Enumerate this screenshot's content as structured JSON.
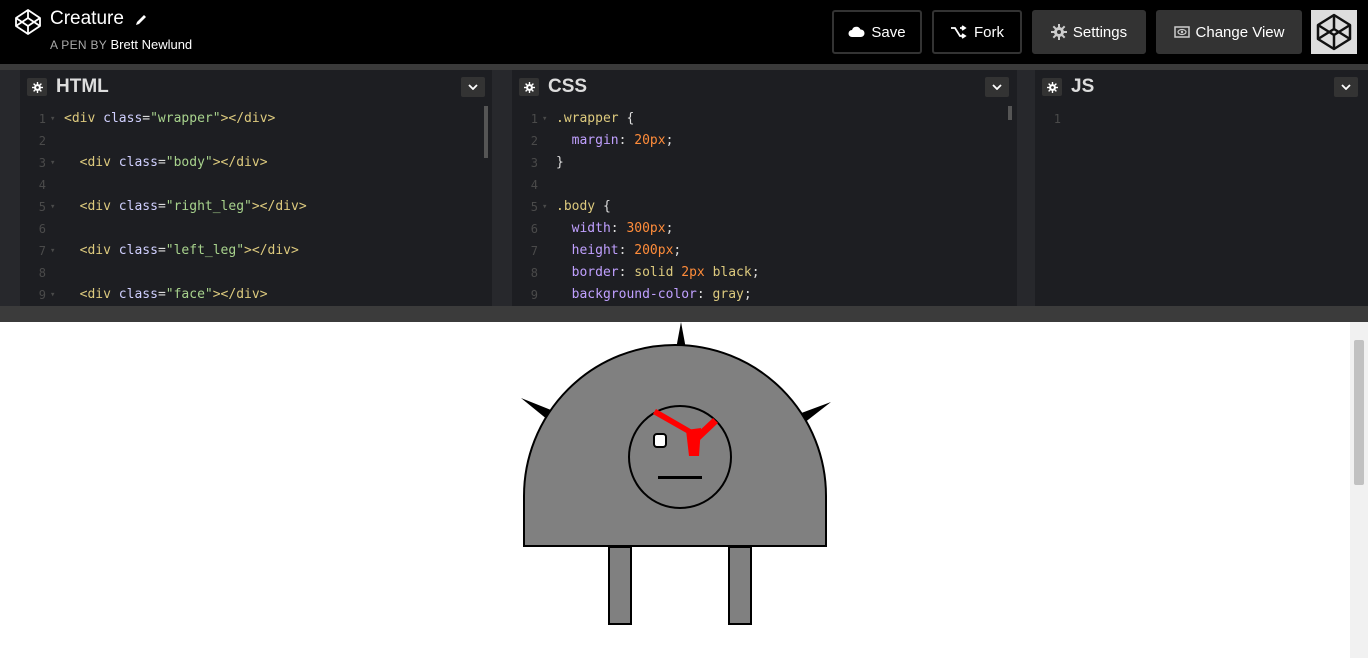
{
  "header": {
    "title": "Creature",
    "byline_prefix": "A PEN BY",
    "author": "Brett Newlund",
    "buttons": {
      "save": "Save",
      "fork": "Fork",
      "settings": "Settings",
      "change_view": "Change View"
    }
  },
  "panes": {
    "html": {
      "title": "HTML",
      "lines": [
        {
          "n": "1",
          "fold": true,
          "code": [
            [
              "tag",
              "<div "
            ],
            [
              "attr",
              "class"
            ],
            [
              "punc",
              "="
            ],
            [
              "str",
              "\"wrapper\""
            ],
            [
              "tag",
              "></div>"
            ]
          ]
        },
        {
          "n": "2",
          "fold": false,
          "code": []
        },
        {
          "n": "3",
          "fold": true,
          "code": [
            [
              "tag",
              "  <div "
            ],
            [
              "attr",
              "class"
            ],
            [
              "punc",
              "="
            ],
            [
              "str",
              "\"body\""
            ],
            [
              "tag",
              "></div>"
            ]
          ]
        },
        {
          "n": "4",
          "fold": false,
          "code": []
        },
        {
          "n": "5",
          "fold": true,
          "code": [
            [
              "tag",
              "  <div "
            ],
            [
              "attr",
              "class"
            ],
            [
              "punc",
              "="
            ],
            [
              "str",
              "\"right_leg\""
            ],
            [
              "tag",
              "></div>"
            ]
          ]
        },
        {
          "n": "6",
          "fold": false,
          "code": []
        },
        {
          "n": "7",
          "fold": true,
          "code": [
            [
              "tag",
              "  <div "
            ],
            [
              "attr",
              "class"
            ],
            [
              "punc",
              "="
            ],
            [
              "str",
              "\"left_leg\""
            ],
            [
              "tag",
              "></div>"
            ]
          ]
        },
        {
          "n": "8",
          "fold": false,
          "code": []
        },
        {
          "n": "9",
          "fold": true,
          "code": [
            [
              "tag",
              "  <div "
            ],
            [
              "attr",
              "class"
            ],
            [
              "punc",
              "="
            ],
            [
              "str",
              "\"face\""
            ],
            [
              "tag",
              "></div>"
            ]
          ]
        }
      ]
    },
    "css": {
      "title": "CSS",
      "lines": [
        {
          "n": "1",
          "fold": true,
          "code": [
            [
              "sel",
              ".wrapper "
            ],
            [
              "punc",
              "{"
            ]
          ]
        },
        {
          "n": "2",
          "fold": false,
          "code": [
            [
              "prop",
              "  margin"
            ],
            [
              "punc",
              ": "
            ],
            [
              "num",
              "20px"
            ],
            [
              "punc",
              ";"
            ]
          ]
        },
        {
          "n": "3",
          "fold": false,
          "code": [
            [
              "punc",
              "}"
            ]
          ]
        },
        {
          "n": "4",
          "fold": false,
          "code": []
        },
        {
          "n": "5",
          "fold": true,
          "code": [
            [
              "sel",
              ".body "
            ],
            [
              "punc",
              "{"
            ]
          ]
        },
        {
          "n": "6",
          "fold": false,
          "code": [
            [
              "prop",
              "  width"
            ],
            [
              "punc",
              ": "
            ],
            [
              "num",
              "300px"
            ],
            [
              "punc",
              ";"
            ]
          ]
        },
        {
          "n": "7",
          "fold": false,
          "code": [
            [
              "prop",
              "  height"
            ],
            [
              "punc",
              ": "
            ],
            [
              "num",
              "200px"
            ],
            [
              "punc",
              ";"
            ]
          ]
        },
        {
          "n": "8",
          "fold": false,
          "code": [
            [
              "prop",
              "  border"
            ],
            [
              "punc",
              ": "
            ],
            [
              "sel",
              "solid "
            ],
            [
              "num",
              "2px "
            ],
            [
              "sel",
              "black"
            ],
            [
              "punc",
              ";"
            ]
          ]
        },
        {
          "n": "9",
          "fold": false,
          "code": [
            [
              "prop",
              "  background-color"
            ],
            [
              "punc",
              ": "
            ],
            [
              "sel",
              "gray"
            ],
            [
              "punc",
              ";"
            ]
          ]
        }
      ]
    },
    "js": {
      "title": "JS",
      "lines": [
        {
          "n": "1",
          "fold": false,
          "code": []
        }
      ]
    }
  },
  "colors": {
    "creature_body": "#808080",
    "creature_outline": "#000000",
    "eyebrow_red": "#ff0000"
  }
}
